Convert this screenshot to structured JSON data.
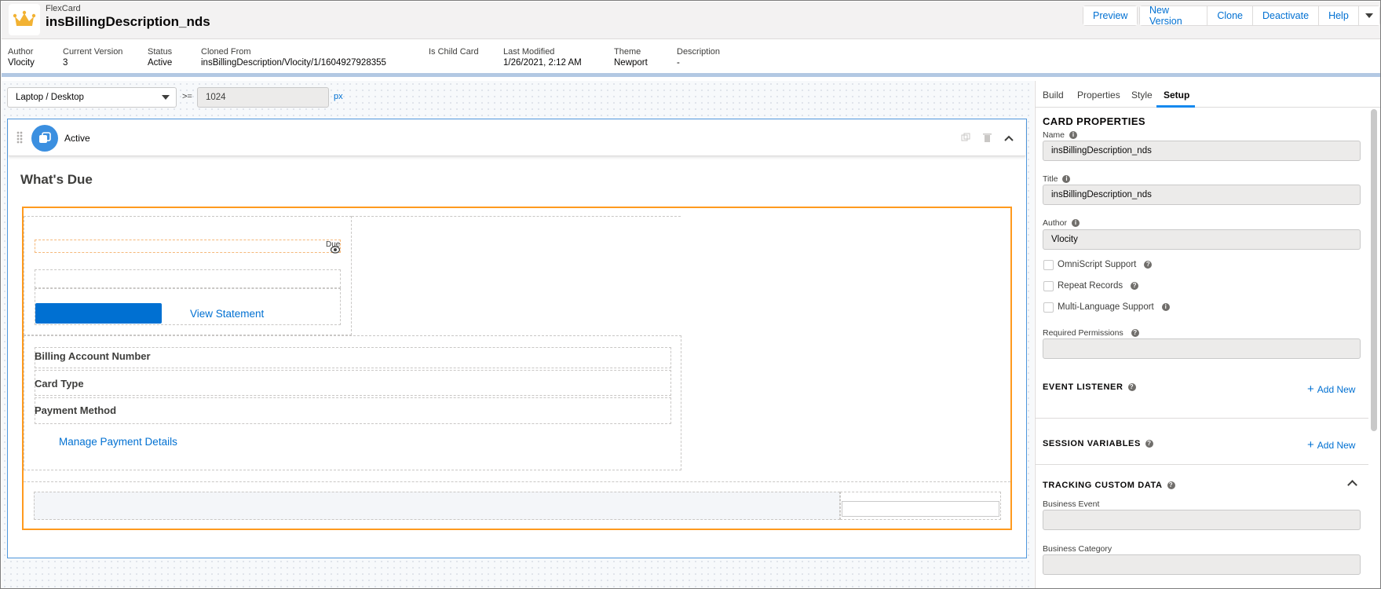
{
  "header": {
    "kind": "FlexCard",
    "title": "insBillingDescription_nds",
    "buttons": [
      "Preview",
      "New Version",
      "Clone",
      "Deactivate",
      "Help"
    ]
  },
  "meta": {
    "author": {
      "label": "Author",
      "value": "Vlocity"
    },
    "version": {
      "label": "Current Version",
      "value": "3"
    },
    "status": {
      "label": "Status",
      "value": "Active"
    },
    "cloned": {
      "label": "Cloned From",
      "value": "insBillingDescription/Vlocity/1/1604927928355"
    },
    "child": {
      "label": "Is Child Card",
      "value": ""
    },
    "modified": {
      "label": "Last Modified",
      "value": "1/26/2021, 2:12 AM"
    },
    "theme": {
      "label": "Theme",
      "value": "Newport"
    },
    "description": {
      "label": "Description",
      "value": "-"
    }
  },
  "viewport": {
    "device": "Laptop / Desktop",
    "operator": ">=",
    "width": "1024",
    "unit": "px"
  },
  "canvas": {
    "state_label": "Active",
    "heading": "What's Due",
    "due_fragment": "Due",
    "view_statement": "View Statement",
    "fields": [
      "Billing Account Number",
      "Card Type",
      "Payment Method"
    ],
    "manage_link": "Manage Payment Details"
  },
  "panel": {
    "tabs": [
      "Build",
      "Properties",
      "Style",
      "Setup"
    ],
    "active_tab": "Setup",
    "card_properties": "CARD PROPERTIES",
    "name_label": "Name",
    "name_value": "insBillingDescription_nds",
    "title_label": "Title",
    "title_value": "insBillingDescription_nds",
    "author_label": "Author",
    "author_value": "Vlocity",
    "omniscript": "OmniScript Support",
    "repeat": "Repeat Records",
    "multilang": "Multi-Language Support",
    "required_perms": "Required Permissions",
    "event_listener": "EVENT LISTENER",
    "session_vars": "SESSION VARIABLES",
    "tracking": "TRACKING CUSTOM DATA",
    "add_new": "Add New",
    "business_event": "Business Event",
    "business_category": "Business Category"
  },
  "colors": {
    "accent": "#0070d2",
    "selection": "#ff9a1e",
    "card_border": "#4f97dc",
    "state_icon": "#3b8fe0"
  }
}
